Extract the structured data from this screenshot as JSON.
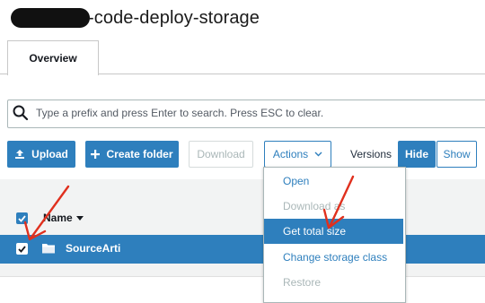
{
  "page": {
    "title_suffix": "-code-deploy-storage"
  },
  "tabs": [
    {
      "label": "Overview"
    }
  ],
  "search": {
    "placeholder": "Type a prefix and press Enter to search. Press ESC to clear.",
    "value": ""
  },
  "toolbar": {
    "upload": "Upload",
    "create_folder": "Create folder",
    "download": "Download",
    "actions": "Actions",
    "versions": "Versions",
    "hide": "Hide",
    "show": "Show"
  },
  "table": {
    "name_header": "Name",
    "rows": [
      {
        "name": "SourceArti",
        "selected": true
      }
    ]
  },
  "actions_menu": {
    "items": [
      {
        "label": "Open",
        "enabled": true
      },
      {
        "label": "Download as",
        "enabled": false
      },
      {
        "label": "Get total size",
        "enabled": true,
        "highlighted": true
      },
      {
        "label": "Change storage class",
        "enabled": true
      },
      {
        "label": "Restore",
        "enabled": false
      }
    ]
  },
  "colors": {
    "accent": "#2e7fbd",
    "annotation": "#e0301e",
    "disabled": "#aab7b8"
  },
  "icons": {
    "search": "search-icon",
    "upload": "upload-icon",
    "create_folder": "plus-icon",
    "actions": "chevron-down-icon",
    "folder": "folder-icon",
    "sort": "caret-down-icon"
  }
}
